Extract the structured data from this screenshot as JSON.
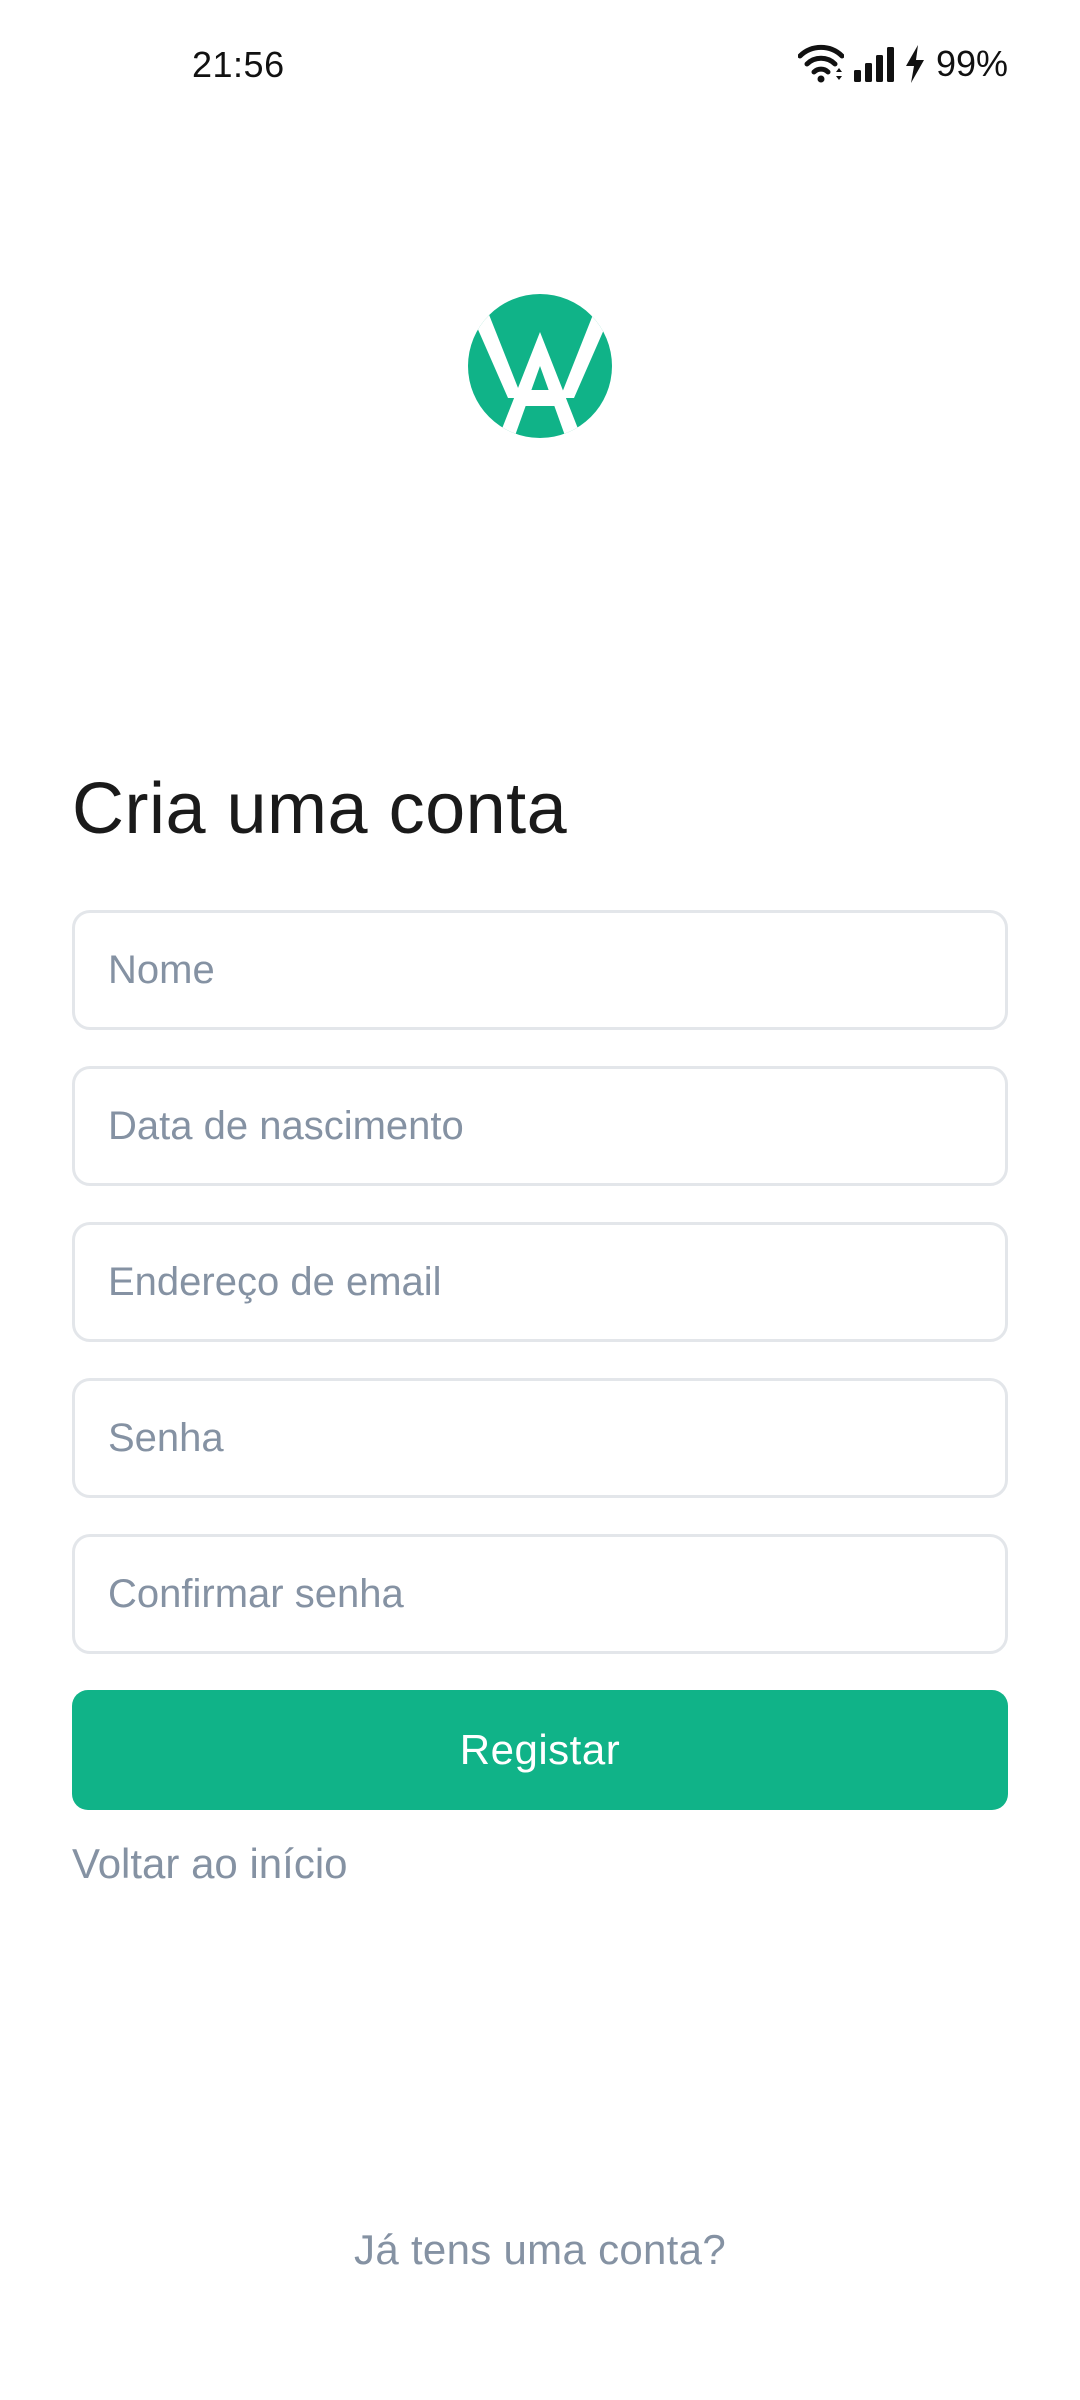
{
  "status_bar": {
    "time": "21:56",
    "battery": "99%",
    "icons": [
      "wifi-icon",
      "signal-icon",
      "charging-icon"
    ]
  },
  "brand": {
    "logo_icon": "logo-icon",
    "accent_color": "#10b388"
  },
  "page": {
    "title": "Cria uma conta"
  },
  "form": {
    "name_placeholder": "Nome",
    "birthdate_placeholder": "Data de nascimento",
    "email_placeholder": "Endereço de email",
    "password_placeholder": "Senha",
    "confirm_password_placeholder": "Confirmar senha",
    "submit_label": "Registar"
  },
  "links": {
    "back_home": "Voltar ao início",
    "have_account": "Já tens uma conta?"
  }
}
